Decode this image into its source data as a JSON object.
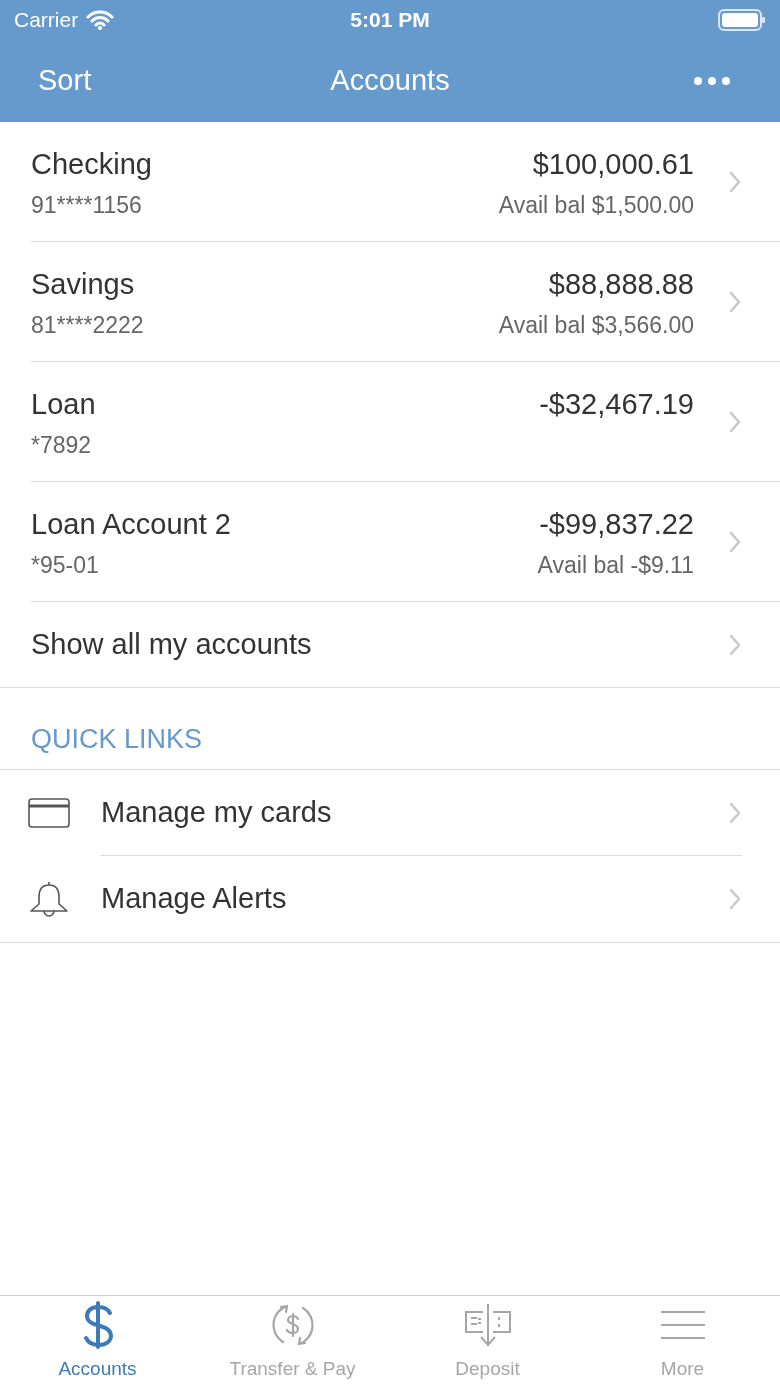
{
  "status_bar": {
    "carrier": "Carrier",
    "time": "5:01 PM"
  },
  "nav": {
    "left": "Sort",
    "title": "Accounts"
  },
  "accounts": [
    {
      "name": "Checking",
      "number": "91****1156",
      "balance": "$100,000.61",
      "avail": "Avail bal $1,500.00"
    },
    {
      "name": "Savings",
      "number": "81****2222",
      "balance": "$88,888.88",
      "avail": "Avail bal $3,566.00"
    },
    {
      "name": "Loan",
      "number": "*7892",
      "balance": "-$32,467.19"
    },
    {
      "name": "Loan Account 2",
      "number": "*95-01",
      "balance": "-$99,837.22",
      "avail": "Avail bal -$9.11"
    }
  ],
  "show_all": "Show all my accounts",
  "quick_links": {
    "heading": "QUICK LINKS",
    "items": [
      {
        "kind": "card",
        "label": "Manage my cards"
      },
      {
        "kind": "bell",
        "label": "Manage Alerts"
      }
    ]
  },
  "tabs": [
    {
      "kind": "dollar",
      "label": "Accounts",
      "selected": true
    },
    {
      "kind": "transfer",
      "label": "Transfer & Pay",
      "selected": false
    },
    {
      "kind": "deposit",
      "label": "Deposit",
      "selected": false
    },
    {
      "kind": "menu",
      "label": "More",
      "selected": false
    }
  ]
}
